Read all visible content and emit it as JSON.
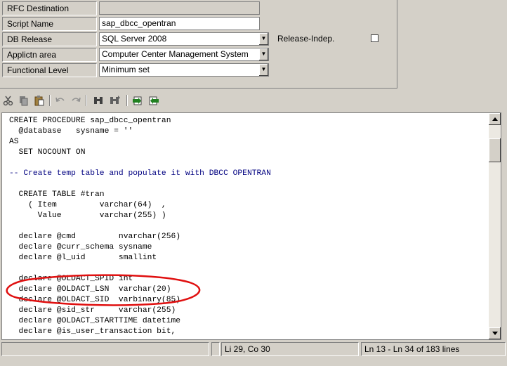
{
  "form": {
    "rfc_destination_label": "RFC Destination",
    "rfc_destination_value": "",
    "script_name_label": "Script Name",
    "script_name_value": "sap_dbcc_opentran",
    "db_release_label": "DB Release",
    "db_release_value": "SQL Server 2008",
    "application_area_label": "Applictn area",
    "application_area_value": "Computer Center Management System",
    "functional_level_label": "Functional Level",
    "functional_level_value": "Minimum set",
    "release_indep_label": "Release-Indep.",
    "release_indep_checked": false
  },
  "toolbar": {
    "icons": [
      "cut-icon",
      "copy-icon",
      "paste-icon",
      "undo-icon",
      "redo-icon",
      "find-icon",
      "find-next-icon",
      "upload-icon",
      "download-icon"
    ]
  },
  "editor": {
    "lines": [
      "CREATE PROCEDURE sap_dbcc_opentran",
      "  @database   sysname = ''",
      "AS",
      "  SET NOCOUNT ON",
      "",
      "-- Create temp table and populate it with DBCC OPENTRAN",
      "",
      "  CREATE TABLE #tran",
      "    ( Item         varchar(64)  ,",
      "      Value        varchar(255) )",
      "",
      "  declare @cmd         nvarchar(256)",
      "  declare @curr_schema sysname",
      "  declare @l_uid       smallint",
      "",
      "  declare @OLDACT_SPID int",
      "  declare @OLDACT_LSN  varchar(20)",
      "  declare @OLDACT_SID  varbinary(85)",
      "  declare @sid_str     varchar(255)",
      "  declare @OLDACT_STARTTIME datetime",
      "  declare @is_user_transaction bit,"
    ],
    "comment_color": "#000080",
    "annotation_color": "#e01010"
  },
  "status": {
    "cell1": "",
    "cell2": "",
    "cursor": "Li 29, Co 30",
    "range": "Ln 13 - Ln 34 of 183 lines"
  }
}
